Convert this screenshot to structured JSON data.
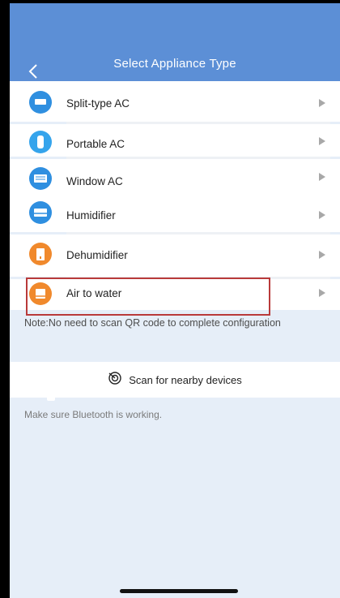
{
  "header": {
    "back_icon": "chevron-left-icon",
    "title": "Select Appliance Type"
  },
  "items": [
    {
      "label": "Split-type AC",
      "icon": "split-ac-icon",
      "color": "#2f8fe0"
    },
    {
      "label": "Portable AC",
      "icon": "portable-ac-icon",
      "color": "#35a4ec"
    },
    {
      "label": "Window AC",
      "icon": "window-ac-icon",
      "color": "#2f8fe0"
    },
    {
      "label": "Humidifier",
      "icon": "humidifier-icon",
      "color": "#2f8fe0"
    },
    {
      "label": "Dehumidifier",
      "icon": "dehumidifier-icon",
      "color": "#f0892c"
    },
    {
      "label": "Air to water",
      "icon": "air-to-water-icon",
      "color": "#f0892c",
      "highlighted": true
    }
  ],
  "note": "Note:No need to scan QR code to complete configuration",
  "scan": {
    "label": "Scan for nearby devices",
    "icon": "scan-icon"
  },
  "hint": "Make sure Bluetooth is working.",
  "colors": {
    "header": "#5c8fd6",
    "background": "#e6eef8",
    "highlight": "#b93a3a"
  }
}
